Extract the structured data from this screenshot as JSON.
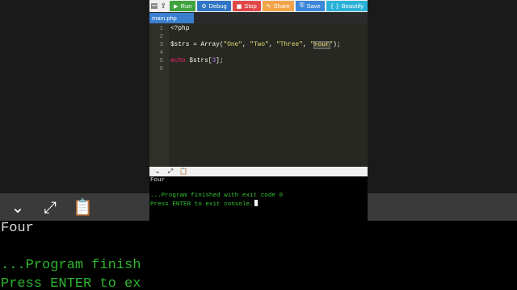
{
  "toolbar": {
    "icons": [
      "file-icon",
      "upload-icon"
    ],
    "buttons": [
      {
        "glyph": "▶",
        "label": "Run"
      },
      {
        "glyph": "⚙",
        "label": "Debug"
      },
      {
        "glyph": "■",
        "label": "Stop"
      },
      {
        "glyph": "✎",
        "label": "Share"
      },
      {
        "glyph": "🖫",
        "label": "Save"
      },
      {
        "glyph": "{ }",
        "label": "Beautify"
      }
    ]
  },
  "tab": {
    "label": "main.php"
  },
  "editor": {
    "line_numbers": [
      "1",
      "2",
      "3",
      "4",
      "5",
      "6"
    ],
    "line1": "<?php",
    "line3_var": "$strs = Array(",
    "line3_s1": "\"One\"",
    "line3_sep1": ", ",
    "line3_s2": "\"Two\"",
    "line3_sep2": ", ",
    "line3_s3": "\"Three\"",
    "line3_sep3": ", ",
    "line3_q1": "\"",
    "line3_s4": "Four",
    "line3_q2": "\"",
    "line3_end": ");",
    "line5_kw": "echo",
    "line5_var": " $strs[",
    "line5_num": "3",
    "line5_end": "];"
  },
  "console": {
    "output": "Four",
    "finished": "...Program finished with exit code 0",
    "prompt": "Press ENTER to exit console."
  },
  "backdrop": {
    "output": "Four",
    "finished": "...Program finish",
    "prompt": "Press ENTER to ex"
  },
  "colors": {
    "run": "#3fa43f",
    "debug": "#2e75c6",
    "stop": "#e04848",
    "share": "#f2a44a",
    "save": "#3b86d8",
    "beautify": "#2ab1d9",
    "console_green": "#34c534"
  }
}
